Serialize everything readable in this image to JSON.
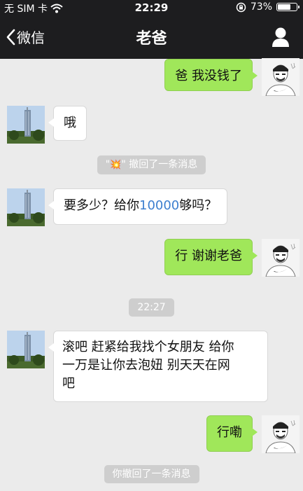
{
  "status_bar": {
    "carrier": "无 SIM 卡",
    "time": "22:29",
    "battery_text": "73%",
    "battery_level": 0.73
  },
  "nav": {
    "back_label": "微信",
    "title": "老爸"
  },
  "messages": [
    {
      "from": "me",
      "text": "爸 我没钱了"
    },
    {
      "from": "dad",
      "text": "哦"
    },
    {
      "type": "system",
      "text_pre": "\"",
      "emoji": "💥",
      "text_post": "\" 撤回了一条消息"
    },
    {
      "from": "dad",
      "text_a": "要多少？给你",
      "text_amount": "10000",
      "text_b": "够吗？"
    },
    {
      "from": "me",
      "text": "行 谢谢老爸"
    },
    {
      "type": "time",
      "text": "22:27"
    },
    {
      "from": "dad",
      "lines": [
        "滚吧 赶紧给我找个女朋友 给你",
        "一万是让你去泡妞 别天天在网",
        "吧"
      ]
    },
    {
      "from": "me",
      "text": "行嘞"
    },
    {
      "type": "system",
      "text": "你撤回了一条消息"
    }
  ],
  "colors": {
    "me_bubble": "#a0e75a",
    "dad_bubble": "#ffffff",
    "highlight": "#3d7fcf",
    "bar": "#1d1d1f"
  }
}
